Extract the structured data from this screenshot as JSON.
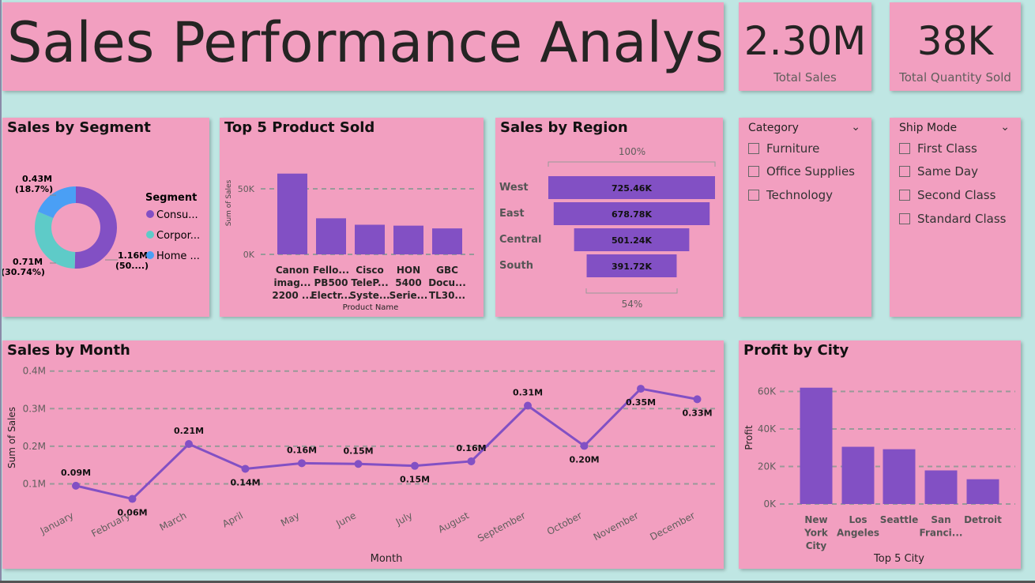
{
  "header": {
    "title": "Sales Performance Analysis"
  },
  "kpis": [
    {
      "value": "2.30M",
      "label": "Total Sales"
    },
    {
      "value": "38K",
      "label": "Total Quantity Sold"
    }
  ],
  "segment_panel": {
    "title": "Sales by Segment",
    "legend_title": "Segment",
    "legend": [
      "Consu...",
      "Corpor...",
      "Home ..."
    ],
    "labels": [
      {
        "value": "1.16M",
        "pct": "(50....)"
      },
      {
        "value": "0.71M",
        "pct": "(30.74%)"
      },
      {
        "value": "0.43M",
        "pct": "(18.7%)"
      }
    ]
  },
  "product_panel": {
    "title": "Top 5 Product Sold",
    "ylabel": "Sum of Sales",
    "xlabel": "Product Name",
    "ticks": [
      "50K",
      "0K"
    ],
    "products": [
      [
        "Canon",
        "imag...",
        "2200 ..."
      ],
      [
        "Fello...",
        "PB500",
        "Electr..."
      ],
      [
        "Cisco",
        "TeleP...",
        "Syste..."
      ],
      [
        "HON",
        "5400",
        "Serie..."
      ],
      [
        "GBC",
        "Docu...",
        "TL30..."
      ]
    ]
  },
  "region_panel": {
    "title": "Sales by Region",
    "top_pct": "100%",
    "bottom_pct": "54%"
  },
  "category_slicer": {
    "title": "Category",
    "items": [
      "Furniture",
      "Office Supplies",
      "Technology"
    ]
  },
  "shipmode_slicer": {
    "title": "Ship Mode",
    "items": [
      "First Class",
      "Same Day",
      "Second Class",
      "Standard Class"
    ]
  },
  "month_panel": {
    "title": "Sales by Month"
  },
  "city_panel": {
    "title": "Profit by City"
  },
  "chart_data": [
    {
      "type": "pie",
      "title": "Sales by Segment",
      "legend_title": "Segment",
      "categories": [
        "Consu...",
        "Corpor...",
        "Home ..."
      ],
      "values": [
        1.16,
        0.71,
        0.43
      ],
      "data_labels": [
        "1.16M (50....)",
        "0.71M (30.74%)",
        "0.43M (18.7%)"
      ],
      "colors": [
        "#8250c4",
        "#5ecbc8",
        "#4a9ff5"
      ]
    },
    {
      "type": "bar",
      "title": "Top 5 Product Sold",
      "xlabel": "Product Name",
      "ylabel": "Sum of Sales",
      "categories": [
        "Canon imag... 2200 ...",
        "Fello... PB500 Electr...",
        "Cisco TeleP... Syste...",
        "HON 5400 Serie...",
        "GBC Docu... TL30..."
      ],
      "values": [
        61600,
        27500,
        22600,
        21900,
        19800
      ],
      "ylim": [
        0,
        62000
      ],
      "yticks": [
        "0K",
        "50K"
      ],
      "grid": true,
      "color": "#8250c4"
    },
    {
      "type": "bar",
      "subtype": "funnel",
      "title": "Sales by Region",
      "categories": [
        "West",
        "East",
        "Central",
        "South"
      ],
      "values": [
        725.46,
        678.78,
        501.24,
        391.72
      ],
      "data_labels": [
        "725.46K",
        "678.78K",
        "501.24K",
        "391.72K"
      ],
      "color": "#8250c4"
    },
    {
      "type": "line",
      "title": "Sales by Month",
      "xlabel": "Month",
      "ylabel": "Sum of Sales",
      "categories": [
        "January",
        "February",
        "March",
        "April",
        "May",
        "June",
        "July",
        "August",
        "September",
        "October",
        "November",
        "December"
      ],
      "values": [
        0.095,
        0.06,
        0.206,
        0.14,
        0.155,
        0.153,
        0.148,
        0.16,
        0.308,
        0.201,
        0.353,
        0.325
      ],
      "data_labels": [
        "0.09M",
        "0.06M",
        "0.21M",
        "0.14M",
        "0.16M",
        "0.15M",
        "0.15M",
        "0.16M",
        "0.31M",
        "0.20M",
        "0.35M",
        "0.33M"
      ],
      "label_pos": [
        "above",
        "below",
        "above",
        "below",
        "above",
        "above",
        "below",
        "above",
        "above",
        "below",
        "below",
        "below"
      ],
      "ylim": [
        0.05,
        0.4
      ],
      "yticks": [
        "0.1M",
        "0.2M",
        "0.3M",
        "0.4M"
      ],
      "grid": true,
      "color": "#8250c4"
    },
    {
      "type": "bar",
      "title": "Profit by City",
      "xlabel": "Top 5 City",
      "ylabel": "Profit",
      "categories": [
        [
          "New",
          "York",
          "City"
        ],
        [
          "Los",
          "Angeles"
        ],
        [
          "Seattle"
        ],
        [
          "San",
          "Franci..."
        ],
        [
          "Detroit"
        ]
      ],
      "values": [
        62000,
        30500,
        29200,
        17900,
        13200
      ],
      "ylim": [
        0,
        65000
      ],
      "yticks": [
        "0K",
        "20K",
        "40K",
        "60K"
      ],
      "grid": true,
      "color": "#8250c4"
    }
  ]
}
